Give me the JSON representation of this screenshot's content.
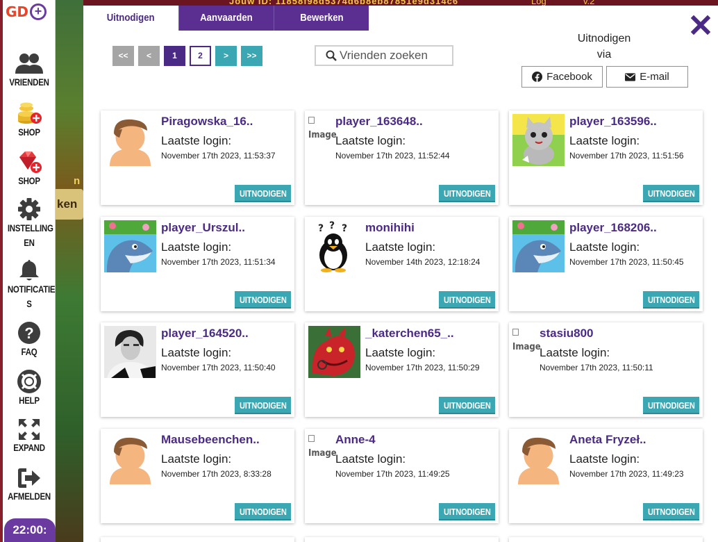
{
  "background": {
    "top_text": "Jouw ID: 11858f98d5374d6b8eb87851e9d314c6",
    "log": "Log",
    "version": "v.2",
    "ken": "ken",
    "n": "n"
  },
  "sidebar": {
    "logo_text": "GD",
    "logo_plus": "+",
    "items": [
      {
        "label": "VRIENDEN",
        "icon": "friends-icon"
      },
      {
        "label": "SHOP",
        "icon": "coins-shop-icon"
      },
      {
        "label": "SHOP",
        "icon": "gems-shop-icon"
      },
      {
        "label": "INSTELLING\nEN",
        "icon": "gear-icon"
      },
      {
        "label": "NOTIFICATIE\nS",
        "icon": "bell-icon"
      },
      {
        "label": "FAQ",
        "icon": "question-icon"
      },
      {
        "label": "HELP",
        "icon": "lifebuoy-icon"
      },
      {
        "label": "EXPAND",
        "icon": "expand-icon"
      },
      {
        "label": "AFMELDEN",
        "icon": "logout-icon"
      }
    ],
    "clock": "22:00:"
  },
  "tabs": [
    {
      "label": "Uitnodigen",
      "active": true
    },
    {
      "label": "Aanvaarden",
      "active": false
    },
    {
      "label": "Bewerken",
      "active": false
    }
  ],
  "close_label": "✕",
  "pager": {
    "first": "<<",
    "prev": "<",
    "pages": [
      "1",
      "2"
    ],
    "current": "1",
    "next": ">",
    "last": ">>"
  },
  "search": {
    "placeholder": "Vrienden zoeken"
  },
  "invite": {
    "line1": "Uitnodigen",
    "line2": "via",
    "facebook": "Facebook",
    "email": "E-mail"
  },
  "broken_image_text": "Image",
  "last_login_label": "Laatste login:",
  "invite_button": "UITNODIGEN",
  "colors": {
    "accent": "#4b2a86",
    "teal": "#3aa7b3",
    "tab_bg": "#5b2f92"
  },
  "friends": [
    {
      "name": "Piragowska_16..",
      "date": "November 17th 2023, 11:53:37",
      "avatar": "default"
    },
    {
      "name": "player_163648..",
      "date": "November 17th 2023, 11:52:44",
      "avatar": "broken"
    },
    {
      "name": "player_163596..",
      "date": "November 17th 2023, 11:51:56",
      "avatar": "cat"
    },
    {
      "name": "player_Urszul..",
      "date": "November 17th 2023, 11:51:34",
      "avatar": "dolphin"
    },
    {
      "name": "monihihi",
      "date": "November 14th 2023, 12:18:24",
      "avatar": "penguin"
    },
    {
      "name": "player_168206..",
      "date": "November 17th 2023, 11:50:45",
      "avatar": "dolphin"
    },
    {
      "name": "player_164520..",
      "date": "November 17th 2023, 11:50:40",
      "avatar": "photo"
    },
    {
      "name": "_katerchen65_..",
      "date": "November 17th 2023, 11:50:29",
      "avatar": "dragon"
    },
    {
      "name": "stasiu800",
      "date": "November 17th 2023, 11:50:11",
      "avatar": "broken"
    },
    {
      "name": "Mausebeenchen..",
      "date": "November 17th 2023, 8:33:28",
      "avatar": "default"
    },
    {
      "name": "Anne-4",
      "date": "November 17th 2023, 11:49:25",
      "avatar": "broken"
    },
    {
      "name": "Aneta Fryzeł..",
      "date": "November 17th 2023, 11:49:23",
      "avatar": "default"
    }
  ]
}
